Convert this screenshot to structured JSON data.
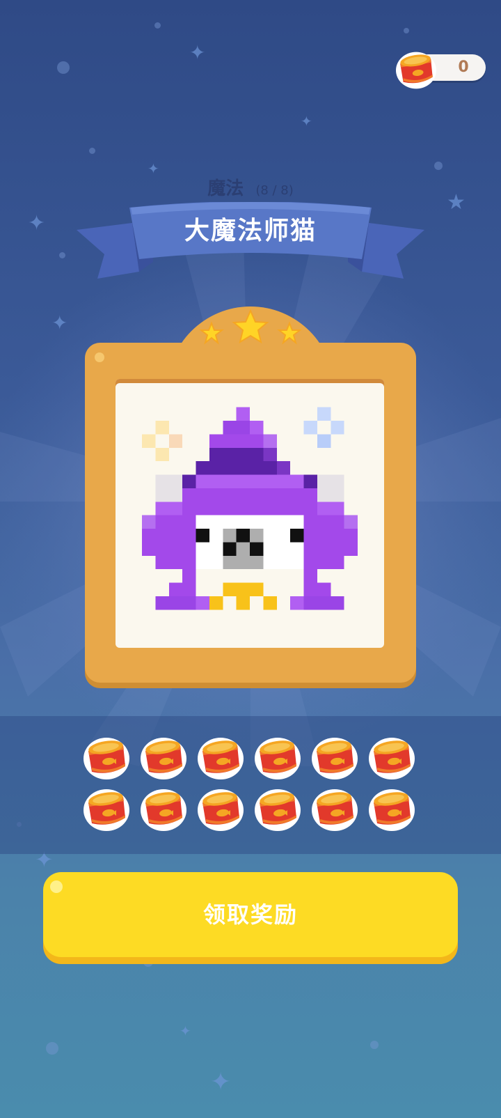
{
  "currency": {
    "value": "0",
    "icon": "cat-food-can-icon"
  },
  "category": {
    "name": "魔法",
    "progress": "(8 / 8)"
  },
  "card": {
    "title": "大魔法师猫",
    "stars": 3
  },
  "rewards": {
    "count": 12,
    "icon": "cat-food-can-icon"
  },
  "claim_button": {
    "label": "领取奖励"
  },
  "colors": {
    "background_top": "#2f4a86",
    "background_bottom": "#4a8cad",
    "frame": "#e8a84a",
    "button": "#fddb24",
    "ribbon": "#5877c7",
    "hat_purple": "#a349ea"
  }
}
